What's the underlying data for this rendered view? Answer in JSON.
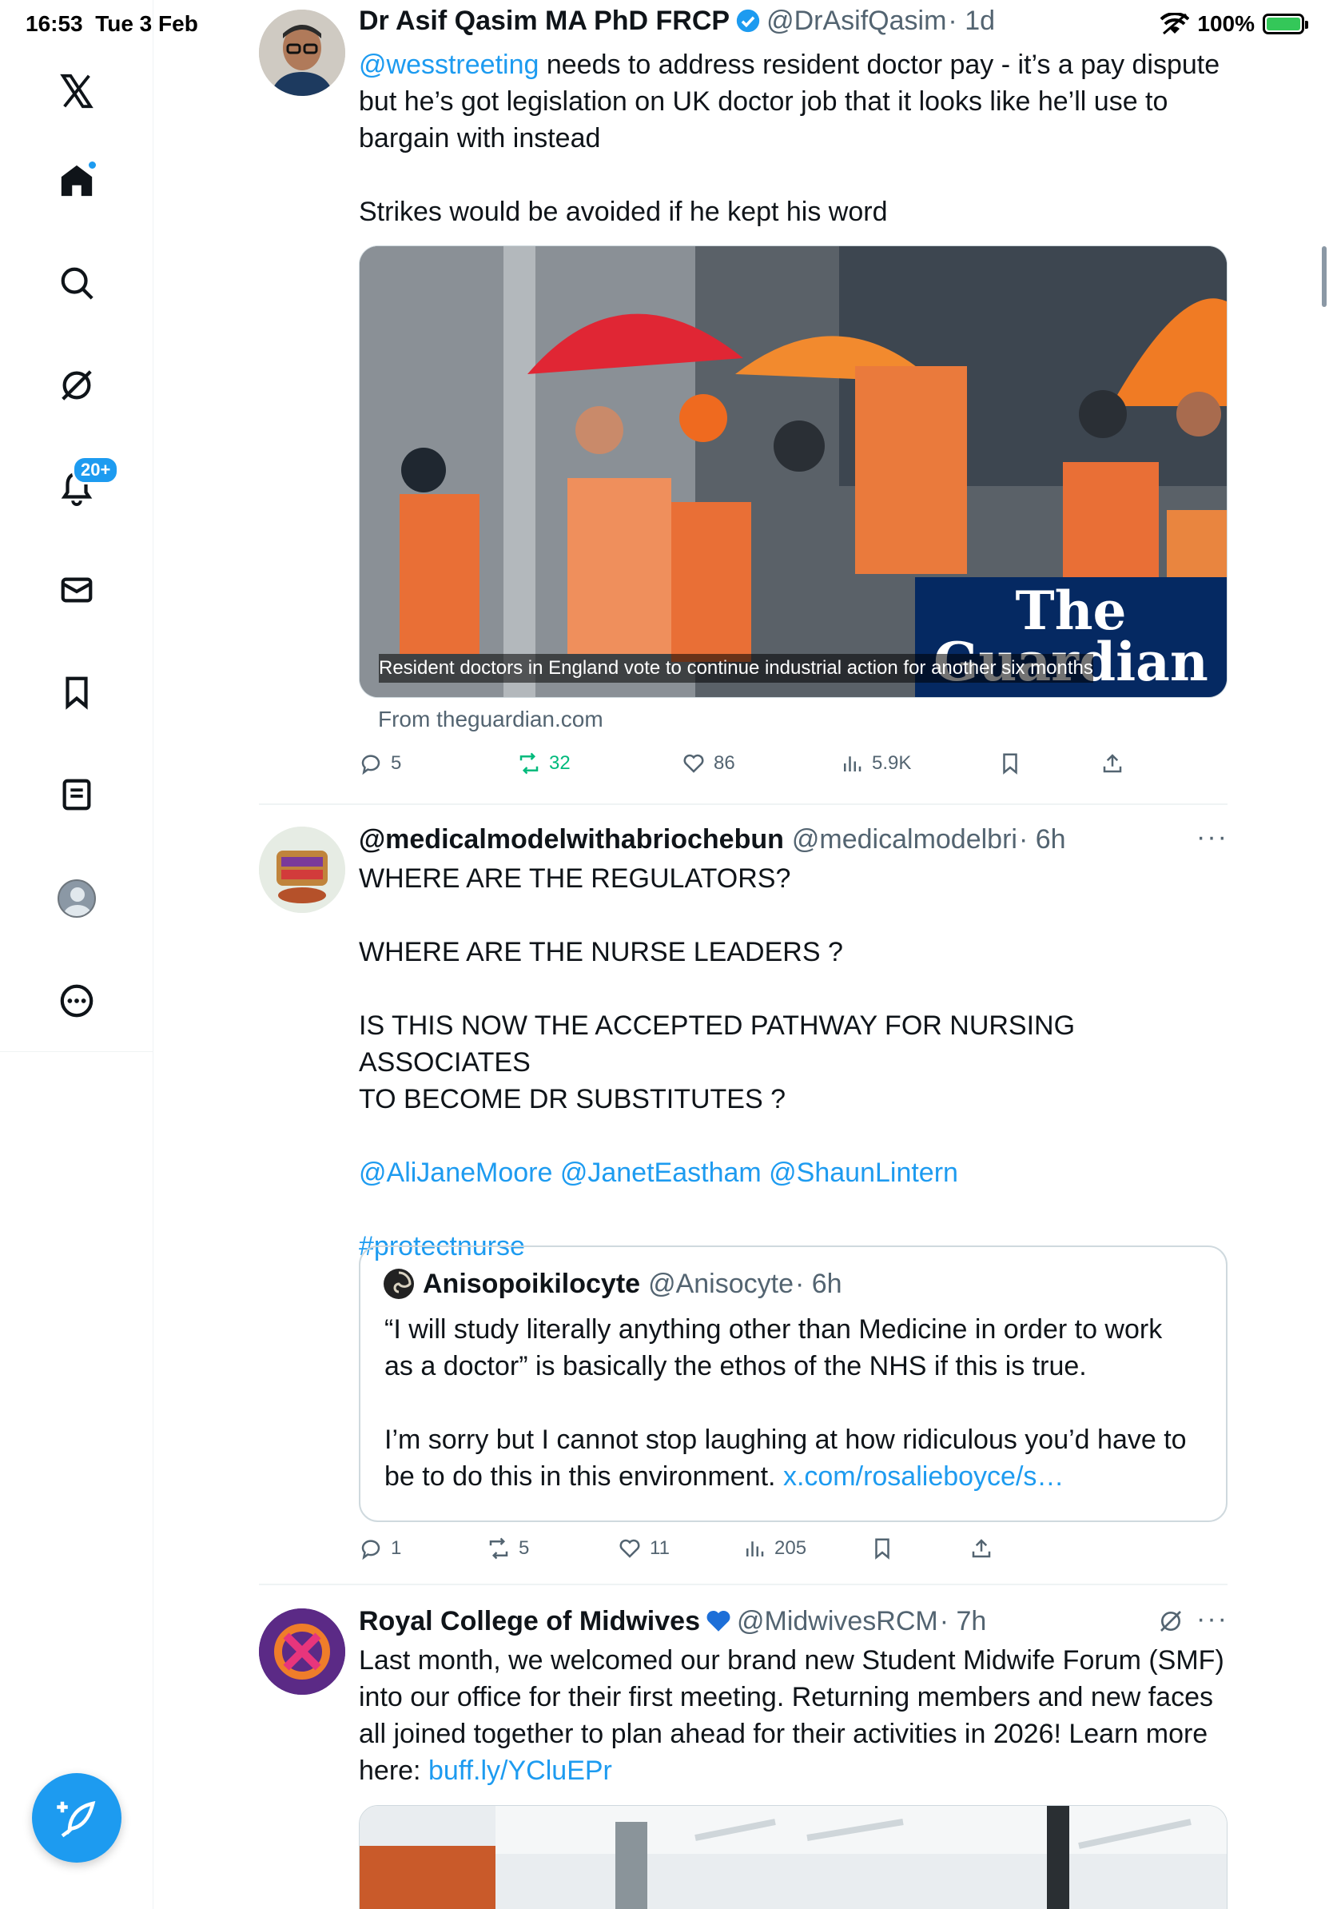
{
  "status_bar": {
    "time": "16:53",
    "date": "Tue 3 Feb",
    "battery": "100%"
  },
  "sidebar": {
    "items": [
      {
        "name": "x-logo"
      },
      {
        "name": "home"
      },
      {
        "name": "search"
      },
      {
        "name": "grok"
      },
      {
        "name": "notifications",
        "badge": "20+"
      },
      {
        "name": "messages"
      },
      {
        "name": "bookmarks"
      },
      {
        "name": "lists"
      },
      {
        "name": "profile"
      },
      {
        "name": "more"
      }
    ]
  },
  "tweets": [
    {
      "name": "Dr Asif Qasim MA PhD FRCP",
      "handle": "@DrAsifQasim",
      "time": "· 1d",
      "body_mention": "@wesstreeting",
      "body_line1_rest": " needs to address resident doctor pay - it’s a pay dispute",
      "body_line2": "but he’s got legislation on UK doctor job that it looks like he’ll use to",
      "body_line3": "bargain with instead",
      "body_line4": "Strikes would be avoided if he kept his word",
      "card_caption": "Resident doctors in England vote to continue industrial action for another six months",
      "card_logo_line1": "The",
      "card_logo_line2": "Guardian",
      "card_from": "From theguardian.com",
      "replies": "5",
      "reposts": "32",
      "likes": "86",
      "views": "5.9K"
    },
    {
      "name": "@medicalmodelwithabriochebun",
      "handle": "@medicalmodelbri",
      "time": "· 6h",
      "more": "···",
      "line1": "WHERE ARE THE REGULATORS?",
      "line2": "WHERE ARE THE NURSE LEADERS ?",
      "line3": "IS THIS NOW THE ACCEPTED PATHWAY FOR NURSING ASSOCIATES",
      "line4": "TO BECOME DR SUBSTITUTES ?",
      "mentions": "@AliJaneMoore @JanetEastham @ShaunLintern",
      "hashtag": "#protectnurse",
      "quote": {
        "name": "Anisopoikilocyte",
        "handle": "@Anisocyte",
        "time": "· 6h",
        "line1": "“I will study literally anything other than Medicine in order to work",
        "line2": "as a doctor” is basically the ethos of the NHS if this is true.",
        "line3": "I’m sorry but I cannot stop laughing at how ridiculous you’d have to",
        "line4_text": "be to do this in this environment. ",
        "line4_link": "x.com/rosalieboyce/s…"
      },
      "replies": "1",
      "reposts": "5",
      "likes": "11",
      "views": "205"
    },
    {
      "name": "Royal College of Midwives",
      "handle": "@MidwivesRCM",
      "time": "· 7h",
      "more": "···",
      "line1": "Last month, we welcomed our brand new Student Midwife Forum (SMF)",
      "line2": "into our office for their first meeting. Returning members and new faces",
      "line3": "all joined together to plan ahead for their activities in 2026! Learn more",
      "line4_text": "here: ",
      "line4_link": "buff.ly/YCluEPr"
    }
  ],
  "colors": {
    "accent": "#1d9bf0",
    "repost_active": "#00ba7c",
    "muted": "#536471",
    "text": "#0f1419"
  }
}
